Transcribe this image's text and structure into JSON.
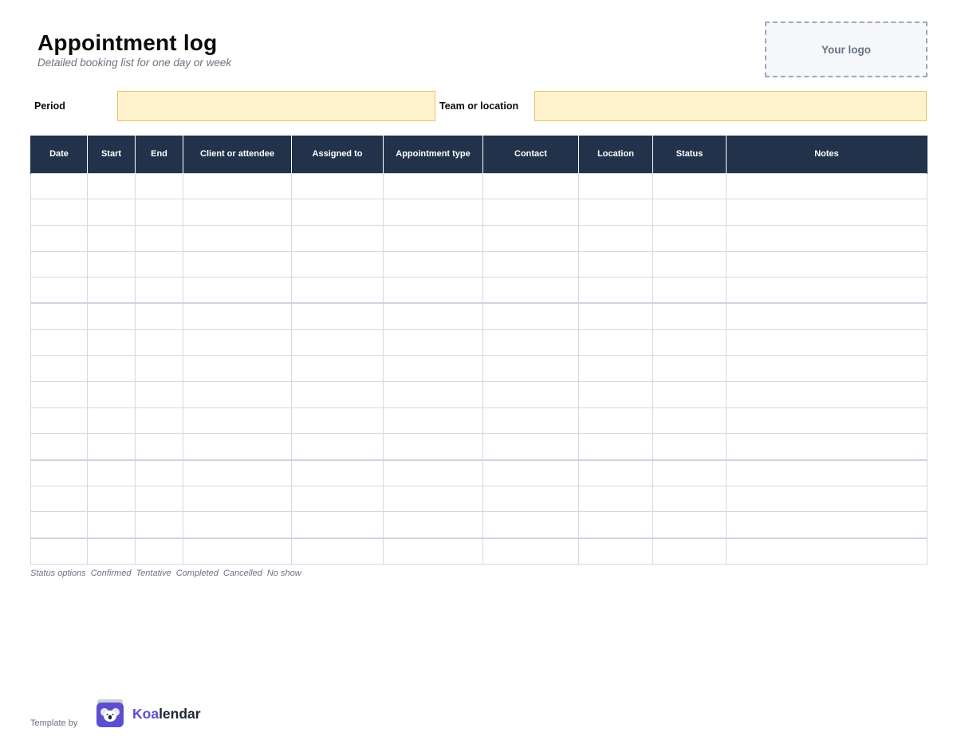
{
  "header": {
    "title": "Appointment log",
    "subtitle": "Detailed booking list for one day or week",
    "logo_placeholder": "Your logo"
  },
  "fields": {
    "period_label": "Period",
    "period_value": "",
    "team_label": "Team or location",
    "team_value": ""
  },
  "table": {
    "columns": [
      "Date",
      "Start",
      "End",
      "Client or attendee",
      "Assigned to",
      "Appointment type",
      "Contact",
      "Location",
      "Status",
      "Notes"
    ],
    "row_count": 15
  },
  "status_legend": {
    "label": "Status options",
    "options": [
      "Confirmed",
      "Tentative",
      "Completed",
      "Cancelled",
      "No show"
    ]
  },
  "footer": {
    "template_by": "Template by",
    "brand_prefix": "Koa",
    "brand_suffix": "lendar",
    "brand_icon": "koala-icon",
    "brand_color": "#5b4fcf"
  },
  "colors": {
    "header_fill": "#22324b",
    "input_fill": "#fff3cd"
  }
}
